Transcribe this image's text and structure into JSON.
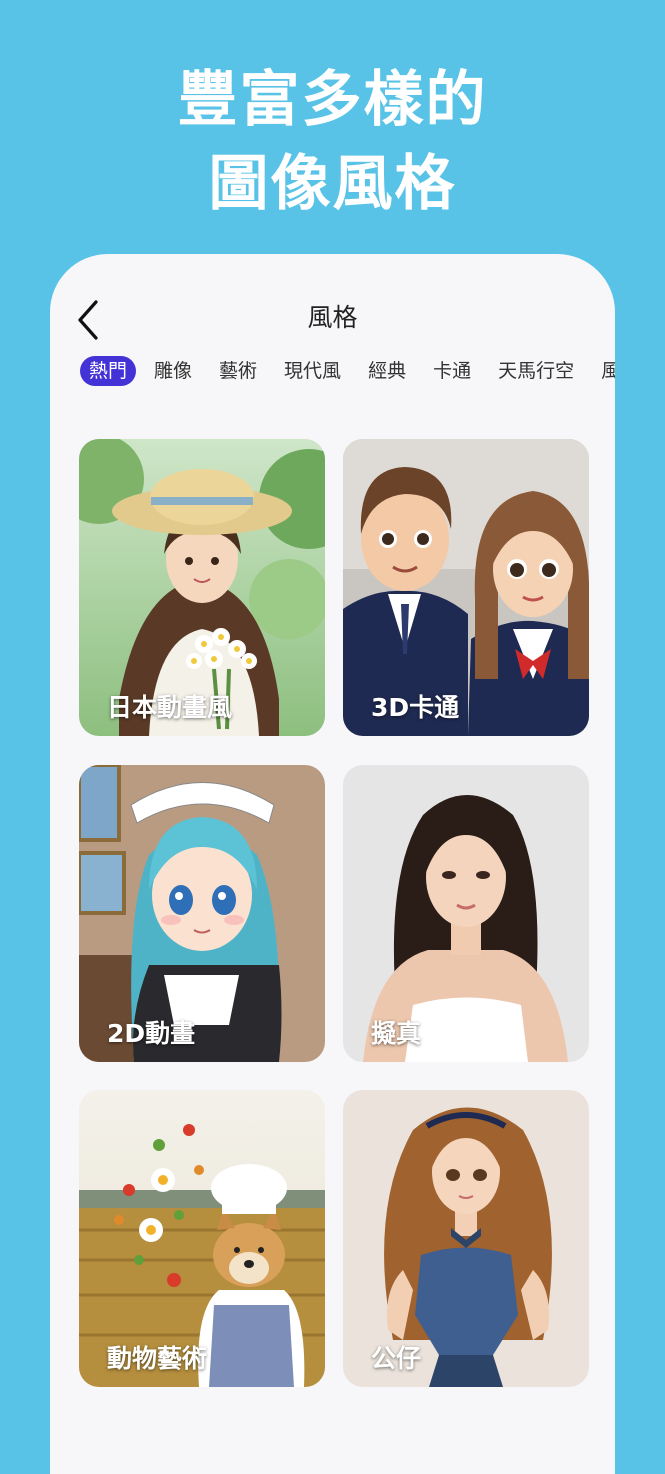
{
  "promo": {
    "line1": "豐富多樣的",
    "line2": "圖像風格"
  },
  "header": {
    "title": "風格",
    "back_icon": "chevron-left-icon"
  },
  "tabs": [
    {
      "label": "熱門",
      "active": true
    },
    {
      "label": "雕像",
      "active": false
    },
    {
      "label": "藝術",
      "active": false
    },
    {
      "label": "現代風",
      "active": false
    },
    {
      "label": "經典",
      "active": false
    },
    {
      "label": "卡通",
      "active": false
    },
    {
      "label": "天馬行空",
      "active": false
    },
    {
      "label": "風",
      "active": false
    }
  ],
  "styles": [
    {
      "label": "日本動畫風"
    },
    {
      "label": "3D卡通"
    },
    {
      "label": "2D動畫"
    },
    {
      "label": "擬真"
    },
    {
      "label": "動物藝術"
    },
    {
      "label": "公仔"
    }
  ],
  "colors": {
    "background": "#58c3e6",
    "accent": "#4333d6",
    "panel": "#f7f7f9"
  }
}
